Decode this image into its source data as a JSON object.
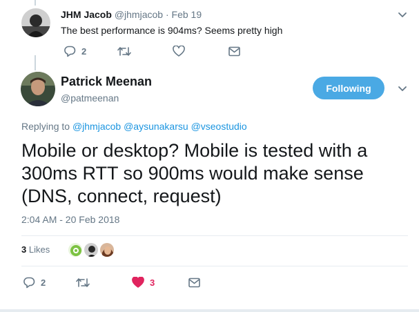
{
  "parent_tweet": {
    "display_name": "JHM Jacob",
    "handle": "@jhmjacob",
    "separator": "·",
    "date": "Feb 19",
    "text": "The best performance is 904ms? Seems pretty high",
    "reply_count": "2"
  },
  "main_tweet": {
    "display_name": "Patrick Meenan",
    "handle": "@patmeenan",
    "follow_label": "Following",
    "replying_prefix": "Replying to",
    "replying_to": [
      "@jhmjacob",
      "@aysunakarsu",
      "@vseostudio"
    ],
    "text": "Mobile or desktop? Mobile is tested with a 300ms RTT so 900ms would make sense (DNS, connect, request)",
    "timestamp": "2:04 AM - 20 Feb 2018",
    "likes_count": "3",
    "likes_label": "Likes",
    "reply_count": "2",
    "like_count_action": "3"
  },
  "colors": {
    "accent": "#1b95e0",
    "follow_button": "#4aa9e4",
    "heart": "#e0245e",
    "muted": "#657786"
  },
  "icons": [
    "reply-icon",
    "retweet-icon",
    "like-icon",
    "dm-icon",
    "chevron-down-icon"
  ]
}
